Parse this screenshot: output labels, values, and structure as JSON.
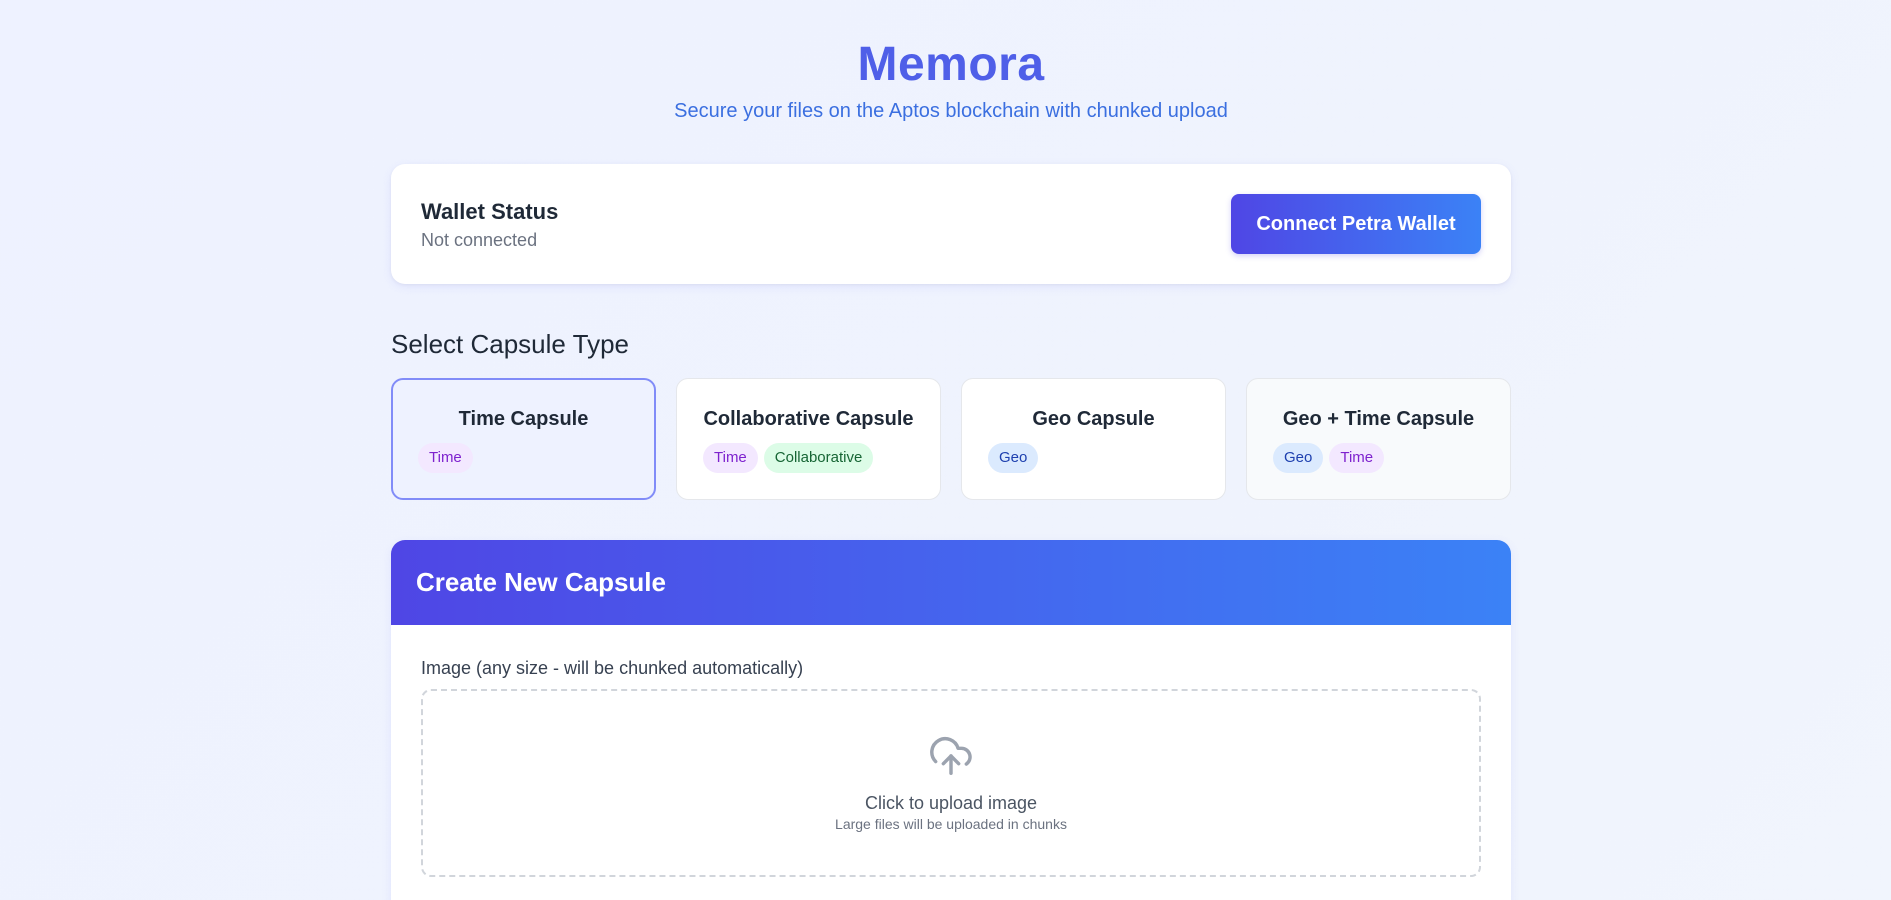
{
  "header": {
    "title": "Memora",
    "subtitle": "Secure your files on the Aptos blockchain with chunked upload"
  },
  "wallet": {
    "title": "Wallet Status",
    "status": "Not connected",
    "connect_label": "Connect Petra Wallet"
  },
  "capsule_section": {
    "title": "Select Capsule Type",
    "types": [
      {
        "name": "Time Capsule",
        "tags": [
          "Time"
        ],
        "selected": true
      },
      {
        "name": "Collaborative Capsule",
        "tags": [
          "Time",
          "Collaborative"
        ],
        "selected": false
      },
      {
        "name": "Geo Capsule",
        "tags": [
          "Geo"
        ],
        "selected": false
      },
      {
        "name": "Geo + Time Capsule",
        "tags": [
          "Geo",
          "Time"
        ],
        "selected": false
      }
    ]
  },
  "create": {
    "title": "Create New Capsule",
    "image_label": "Image (any size - will be chunked automatically)",
    "upload_text": "Click to upload image",
    "upload_hint": "Large files will be uploaded in chunks",
    "upload_icon": "cloud-upload-icon"
  },
  "colors": {
    "brand": "#4f5fe8",
    "gradient_start": "#4f46e5",
    "gradient_end": "#3b82f6",
    "tag_time": "#f3e8ff",
    "tag_collaborative": "#dcfce7",
    "tag_geo": "#dbeafe"
  }
}
